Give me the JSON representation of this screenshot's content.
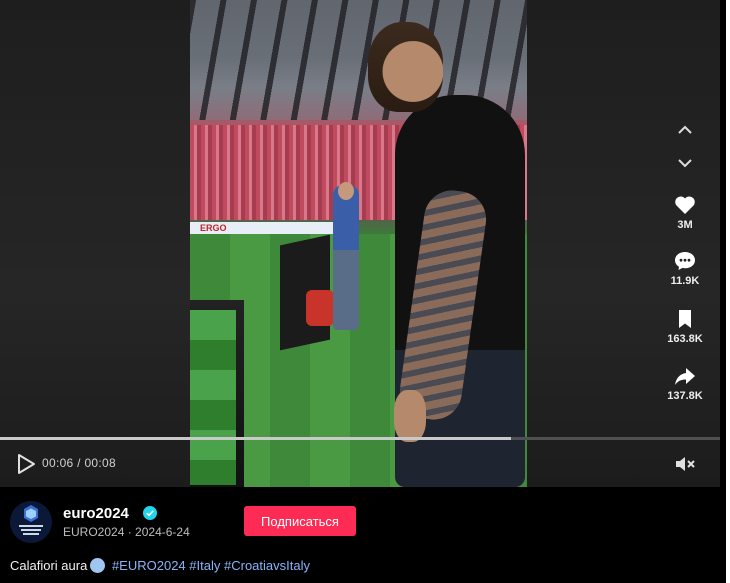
{
  "player": {
    "elapsed": "00:06",
    "duration": "00:08",
    "time_separator": " / ",
    "progress": 0.71,
    "ad_text": "ERGO"
  },
  "sidebar": {
    "up_icon": "chevron-up-icon",
    "down_icon": "chevron-down-icon",
    "like": {
      "icon": "heart-icon",
      "count": "3M"
    },
    "comment": {
      "icon": "comment-icon",
      "count": "11.9K"
    },
    "save": {
      "icon": "bookmark-icon",
      "count": "163.8K"
    },
    "share": {
      "icon": "share-arrow-icon",
      "count": "137.8K"
    }
  },
  "author": {
    "username": "euro2024",
    "display_name": "EURO2024",
    "date": "2024-6-24",
    "separator": " · ",
    "verified_icon": "verified-badge-icon",
    "follow_label": "Подписаться"
  },
  "caption": {
    "text": "Calafiori aura",
    "emoji": "cold-face-emoji",
    "hashtags": [
      "#EURO2024",
      "#Italy",
      "#CroatiavsItaly"
    ]
  },
  "colors": {
    "accent": "#fe2c55",
    "hashtag": "#8ab4f8",
    "verified": "#20d5ec"
  }
}
